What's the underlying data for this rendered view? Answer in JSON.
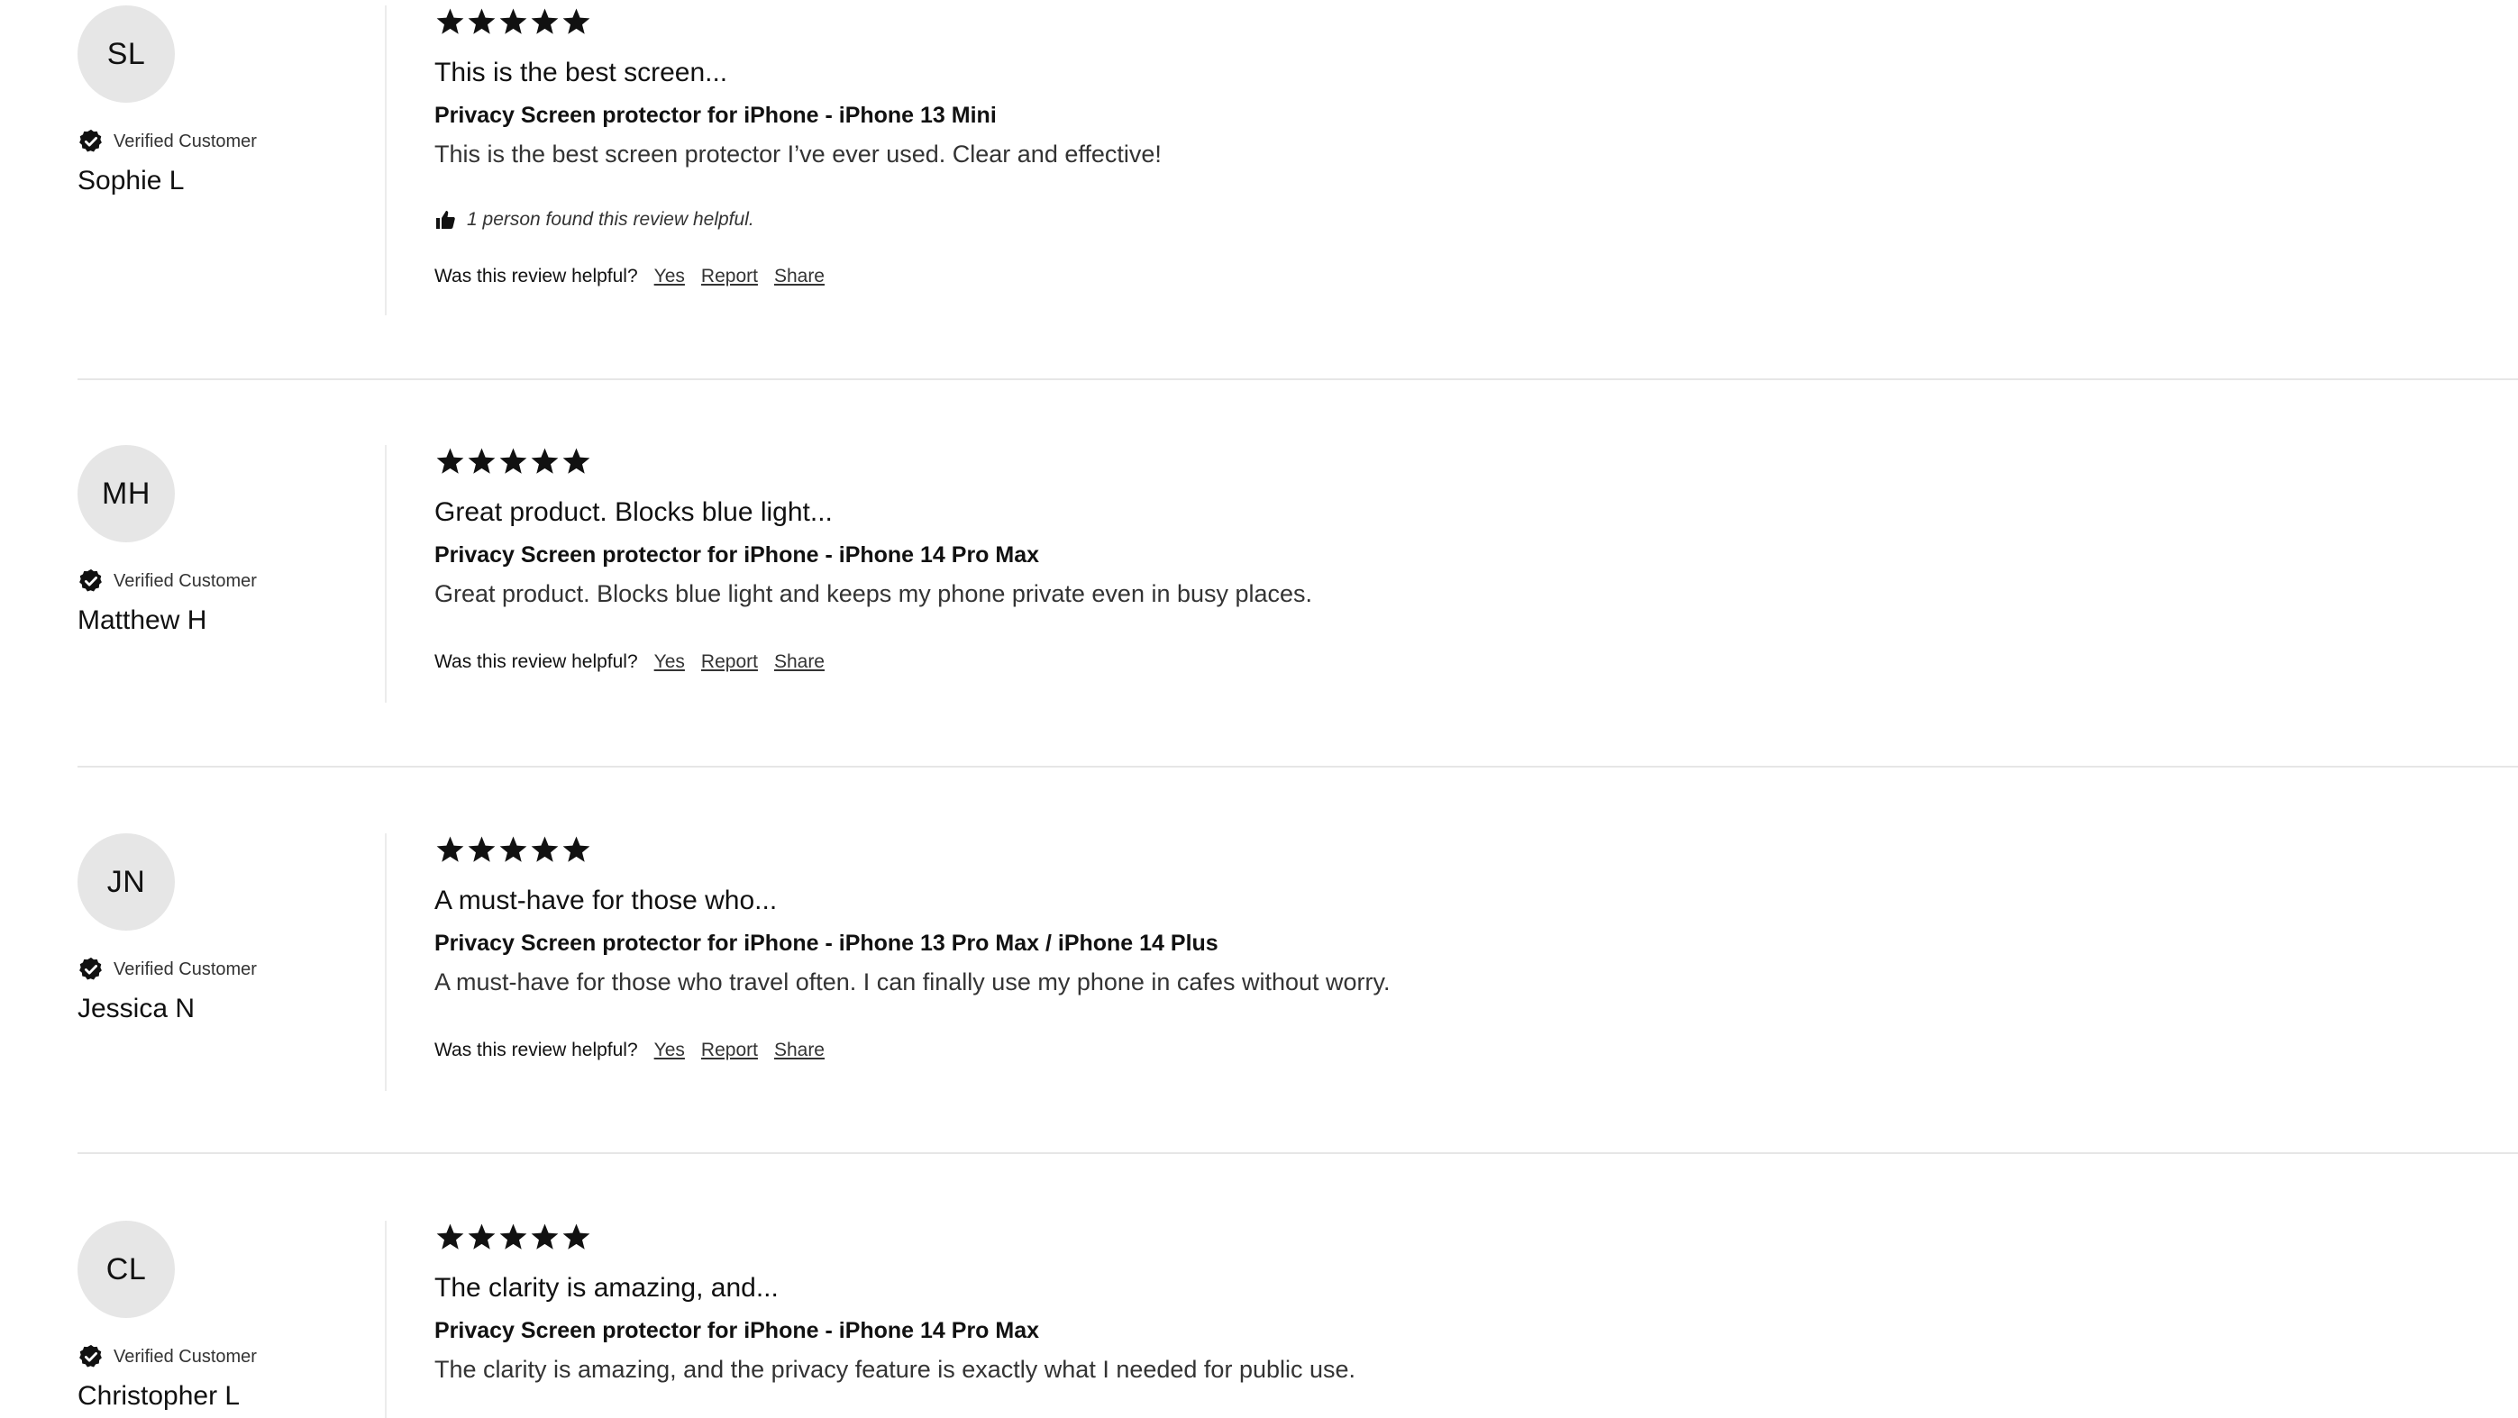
{
  "reviews": [
    {
      "initials": "SL",
      "verified_label": "Verified Customer",
      "name": "Sophie L",
      "rating": 5,
      "title": "This is the best screen...",
      "product": "Privacy Screen protector for iPhone - iPhone 13 Mini",
      "body": "This is the best screen protector I’ve ever used. Clear and effective!",
      "helpful_count_text": "1 person found this review helpful.",
      "helpful_question": "Was this review helpful?",
      "yes_label": "Yes",
      "report_label": "Report",
      "share_label": "Share"
    },
    {
      "initials": "MH",
      "verified_label": "Verified Customer",
      "name": "Matthew H",
      "rating": 5,
      "title": "Great product. Blocks blue light...",
      "product": "Privacy Screen protector for iPhone - iPhone 14 Pro Max",
      "body": "Great product. Blocks blue light and keeps my phone private even in busy places.",
      "helpful_question": "Was this review helpful?",
      "yes_label": "Yes",
      "report_label": "Report",
      "share_label": "Share"
    },
    {
      "initials": "JN",
      "verified_label": "Verified Customer",
      "name": "Jessica N",
      "rating": 5,
      "title": "A must-have for those who...",
      "product": "Privacy Screen protector for iPhone - iPhone 13 Pro Max / iPhone 14 Plus",
      "body": "A must-have for those who travel often. I can finally use my phone in cafes without worry.",
      "helpful_question": "Was this review helpful?",
      "yes_label": "Yes",
      "report_label": "Report",
      "share_label": "Share"
    },
    {
      "initials": "CL",
      "verified_label": "Verified Customer",
      "name": "Christopher L",
      "rating": 5,
      "title": "The clarity is amazing, and...",
      "product": "Privacy Screen protector for iPhone - iPhone 14 Pro Max",
      "body": "The clarity is amazing, and the privacy feature is exactly what I needed for public use."
    }
  ],
  "icons": {
    "star": "star-icon",
    "verified": "verified-check-icon",
    "thumb": "thumbs-up-icon"
  },
  "colors": {
    "avatar_bg": "#e6e6e6",
    "separator": "#e6e6e6",
    "text": "#111111"
  }
}
